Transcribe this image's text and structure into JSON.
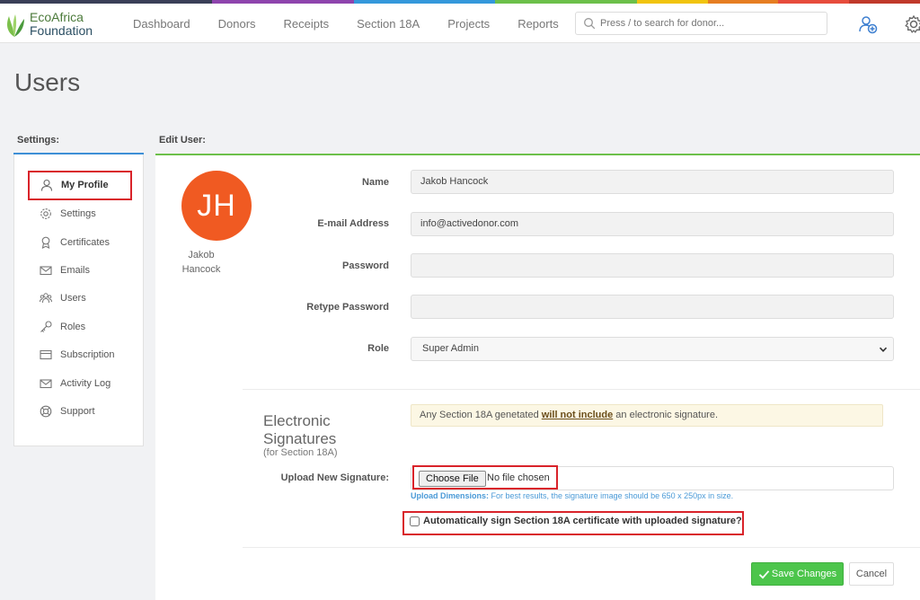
{
  "colors": {
    "topbar": [
      "#3a3f58",
      "#3a3f58",
      "#3a3f58",
      "#8e44ad",
      "#8e44ad",
      "#3498db",
      "#3498db",
      "#6cc04a",
      "#6cc04a",
      "#f1c40f",
      "#e67e22",
      "#e74c3c",
      "#c0392b"
    ],
    "accent_blue": "#3d8fd6",
    "accent_green": "#6cc04a",
    "avatar_bg": "#f05a22",
    "highlight_red": "#d9232a",
    "save_green": "#4cc54b"
  },
  "logo": {
    "line1": "EcoAfrica",
    "line2": "Foundation"
  },
  "nav": [
    "Dashboard",
    "Donors",
    "Receipts",
    "Section 18A",
    "Projects",
    "Reports"
  ],
  "search": {
    "placeholder": "Press / to search for donor..."
  },
  "header_icons": [
    "add-user-icon",
    "gear-icon"
  ],
  "page": {
    "title": "Users"
  },
  "settings": {
    "label": "Settings:",
    "items": [
      {
        "label": "My Profile",
        "icon": "user-icon",
        "active": true
      },
      {
        "label": "Settings",
        "icon": "gear-icon"
      },
      {
        "label": "Certificates",
        "icon": "award-icon"
      },
      {
        "label": "Emails",
        "icon": "envelope-icon"
      },
      {
        "label": "Users",
        "icon": "users-icon"
      },
      {
        "label": "Roles",
        "icon": "key-icon"
      },
      {
        "label": "Subscription",
        "icon": "card-icon"
      },
      {
        "label": "Activity Log",
        "icon": "envelope-icon"
      },
      {
        "label": "Support",
        "icon": "lifebuoy-icon"
      }
    ]
  },
  "edit": {
    "label": "Edit User:",
    "avatar_initials": "JH",
    "avatar_name_line1": "Jakob",
    "avatar_name_line2": "Hancock",
    "fields": {
      "name_label": "Name",
      "name_value": "Jakob Hancock",
      "email_label": "E-mail Address",
      "email_value": "info@activedonor.com",
      "password_label": "Password",
      "password_value": "",
      "retype_label": "Retype Password",
      "retype_value": "",
      "role_label": "Role",
      "role_value": "Super Admin"
    },
    "signatures": {
      "title_line1": "Electronic",
      "title_line2": "Signatures",
      "subtitle": "(for Section 18A)",
      "notice_pre": "Any Section 18A genetated ",
      "notice_bold": "will not include",
      "notice_post": " an electronic signature.",
      "upload_label": "Upload New Signature:",
      "choose_file": "Choose File",
      "no_file": "No file chosen",
      "hint_bold": "Upload Dimensions:",
      "hint_text": " For best results, the signature image should be 650 x 250px in size.",
      "auto_sign_label": "Automatically sign Section 18A certificate with uploaded signature?",
      "auto_sign_checked": false
    },
    "save_label": "Save Changes",
    "cancel_label": "Cancel"
  }
}
